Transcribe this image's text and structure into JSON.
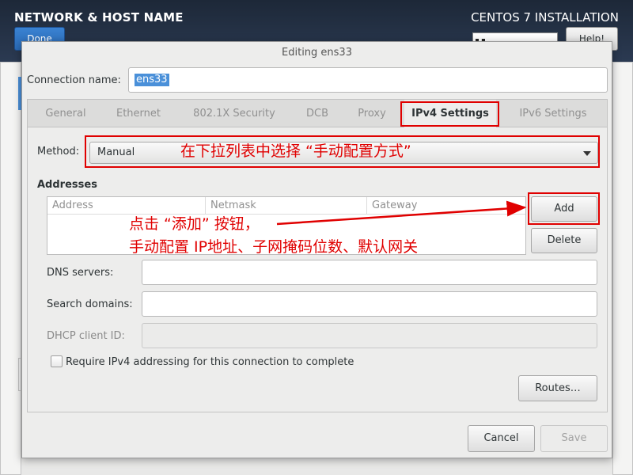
{
  "header": {
    "hub_title": "NETWORK & HOST NAME",
    "install_title": "CENTOS 7 INSTALLATION",
    "done_label": "Done",
    "help_label": "Help!"
  },
  "dialog": {
    "title": "Editing ens33",
    "connection_name_label": "Connection name:",
    "connection_name_value": "ens33",
    "tabs": [
      {
        "label": "General"
      },
      {
        "label": "Ethernet"
      },
      {
        "label": "802.1X Security"
      },
      {
        "label": "DCB"
      },
      {
        "label": "Proxy"
      },
      {
        "label": "IPv4 Settings",
        "active": true
      },
      {
        "label": "IPv6 Settings"
      }
    ],
    "method_label": "Method:",
    "method_value": "Manual",
    "addresses_heading": "Addresses",
    "address_columns": [
      "Address",
      "Netmask",
      "Gateway"
    ],
    "add_label": "Add",
    "delete_label": "Delete",
    "dns_label": "DNS servers:",
    "dns_value": "",
    "search_label": "Search domains:",
    "search_value": "",
    "dhcp_label": "DHCP client ID:",
    "dhcp_value": "",
    "require_ipv4_label": "Require IPv4 addressing for this connection to complete",
    "routes_label": "Routes…",
    "cancel_label": "Cancel",
    "save_label": "Save"
  },
  "annotations": {
    "method_note": "在下拉列表中选择 “手动配置方式”",
    "add_note_line1": "点击 “添加” 按钮，",
    "add_note_line2": "手动配置 IP地址、子网掩码位数、默认网关"
  },
  "colors": {
    "annotation_red": "#e00000",
    "selection_blue": "#4a90d9",
    "header_dark": "#1d2838"
  },
  "icons": {
    "keyboard": "keyboard-icon",
    "combo_arrow": "dropdown-arrow-icon"
  }
}
